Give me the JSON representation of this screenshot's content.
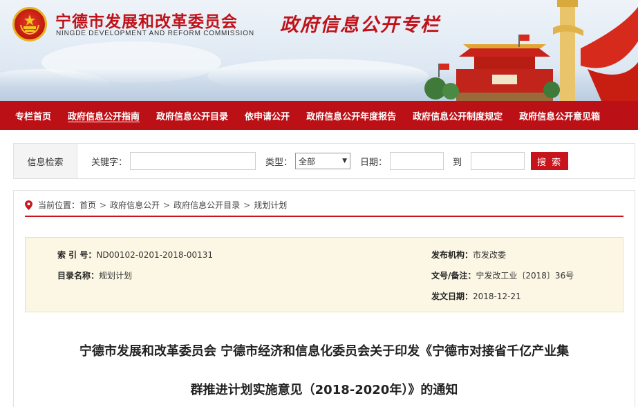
{
  "header": {
    "org_cn": "宁德市发展和改革委员会",
    "org_en": "NINGDE DEVELOPMENT AND REFORM COMMISSION",
    "banner_title": "政府信息公开专栏",
    "accent_color": "#bb1016"
  },
  "nav": {
    "items": [
      {
        "label": "专栏首页"
      },
      {
        "label": "政府信息公开指南"
      },
      {
        "label": "政府信息公开目录"
      },
      {
        "label": "依申请公开"
      },
      {
        "label": "政府信息公开年度报告"
      },
      {
        "label": "政府信息公开制度规定"
      },
      {
        "label": "政府信息公开意见箱"
      }
    ]
  },
  "search": {
    "section_label": "信息检索",
    "keyword_label": "关键字：",
    "keyword_value": "",
    "type_label": "类型：",
    "type_selected": "全部",
    "date_label": "日期：",
    "date_from": "",
    "to_label": "到",
    "date_to": "",
    "button_label": "搜 索"
  },
  "breadcrumb": {
    "prefix": "当前位置：",
    "items": [
      "首页",
      "政府信息公开",
      "政府信息公开目录",
      "规划计划"
    ],
    "separator": ">"
  },
  "meta": {
    "index_label": "索 引 号：",
    "index_value": "ND00102-0201-2018-00131",
    "category_label": "目录名称：",
    "category_value": "规划计划",
    "publisher_label": "发布机构：",
    "publisher_value": "市发改委",
    "doc_no_label": "文号/备注：",
    "doc_no_value": "宁发改工业〔2018〕36号",
    "date_label": "发文日期：",
    "date_value": "2018-12-21"
  },
  "document": {
    "title_line1": "宁德市发展和改革委员会 宁德市经济和信息化委员会关于印发《宁德市对接省千亿产业集",
    "title_line2": "群推进计划实施意见（2018-2020年）》的通知"
  }
}
